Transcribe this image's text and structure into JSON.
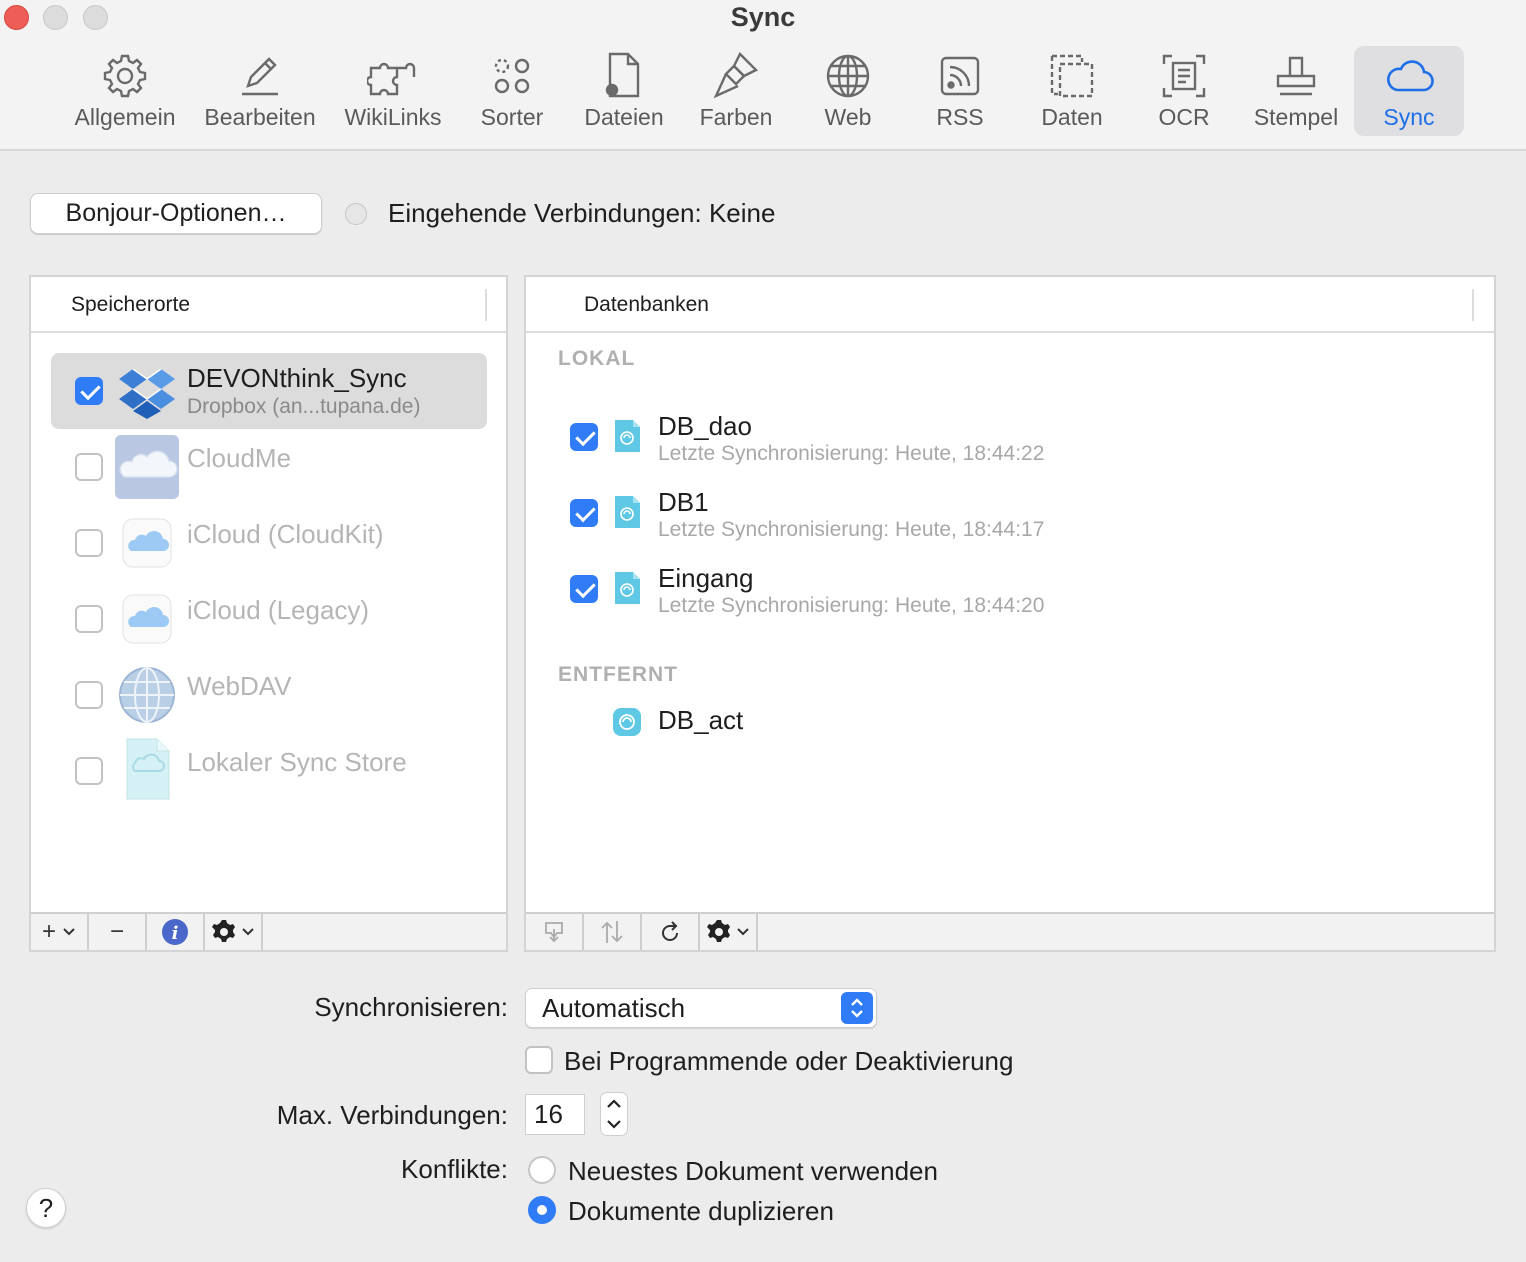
{
  "window": {
    "title": "Sync"
  },
  "toolbar": {
    "items": [
      {
        "label": "Allgemein",
        "icon": "gear-icon"
      },
      {
        "label": "Bearbeiten",
        "icon": "pencil-icon"
      },
      {
        "label": "WikiLinks",
        "icon": "puzzle-icon"
      },
      {
        "label": "Sorter",
        "icon": "sorter-icon"
      },
      {
        "label": "Dateien",
        "icon": "file-gear-icon"
      },
      {
        "label": "Farben",
        "icon": "brush-icon"
      },
      {
        "label": "Web",
        "icon": "globe-icon"
      },
      {
        "label": "RSS",
        "icon": "rss-icon"
      },
      {
        "label": "Daten",
        "icon": "data-frame-icon"
      },
      {
        "label": "OCR",
        "icon": "ocr-icon"
      },
      {
        "label": "Stempel",
        "icon": "stamp-icon"
      },
      {
        "label": "Sync",
        "icon": "cloud-icon"
      }
    ],
    "active": "Sync",
    "accent_color": "#1e6fe8"
  },
  "bonjour": {
    "button_label": "Bonjour-Optionen…",
    "status_text": "Eingehende Verbindungen: Keine"
  },
  "locations": {
    "header": "Speicherorte",
    "items": [
      {
        "name": "DEVONthink_Sync",
        "subtitle": "Dropbox (an...tupana.de)",
        "checked": true,
        "selected": true,
        "icon": "dropbox-icon"
      },
      {
        "name": "CloudMe",
        "checked": false,
        "icon": "cloudme-icon"
      },
      {
        "name": "iCloud (CloudKit)",
        "checked": false,
        "icon": "icloud-icon"
      },
      {
        "name": "iCloud (Legacy)",
        "checked": false,
        "icon": "icloud-icon"
      },
      {
        "name": "WebDAV",
        "checked": false,
        "icon": "webdav-globe-icon"
      },
      {
        "name": "Lokaler Sync Store",
        "checked": false,
        "icon": "sync-store-file-icon"
      }
    ],
    "footer": [
      "+",
      "−",
      "i",
      "gear"
    ]
  },
  "databases": {
    "header": "Datenbanken",
    "local_heading": "LOKAL",
    "remote_heading": "ENTFERNT",
    "local": [
      {
        "name": "DB_dao",
        "status": "Letzte Synchronisierung: Heute, 18:44:22",
        "checked": true
      },
      {
        "name": "DB1",
        "status": "Letzte Synchronisierung: Heute, 18:44:17",
        "checked": true
      },
      {
        "name": "Eingang",
        "status": "Letzte Synchronisierung: Heute, 18:44:20",
        "checked": true
      }
    ],
    "remote": [
      {
        "name": "DB_act"
      }
    ]
  },
  "form": {
    "sync_label": "Synchronisieren:",
    "sync_value": "Automatisch",
    "on_quit_label": "Bei Programmende oder Deaktivierung",
    "on_quit_checked": false,
    "max_conn_label": "Max. Verbindungen:",
    "max_conn_value": "16",
    "conflicts_label": "Konflikte:",
    "conflict_options": [
      "Neuestes Dokument verwenden",
      "Dokumente duplizieren"
    ],
    "conflict_selected": "Dokumente duplizieren"
  },
  "help": {
    "label": "?"
  }
}
